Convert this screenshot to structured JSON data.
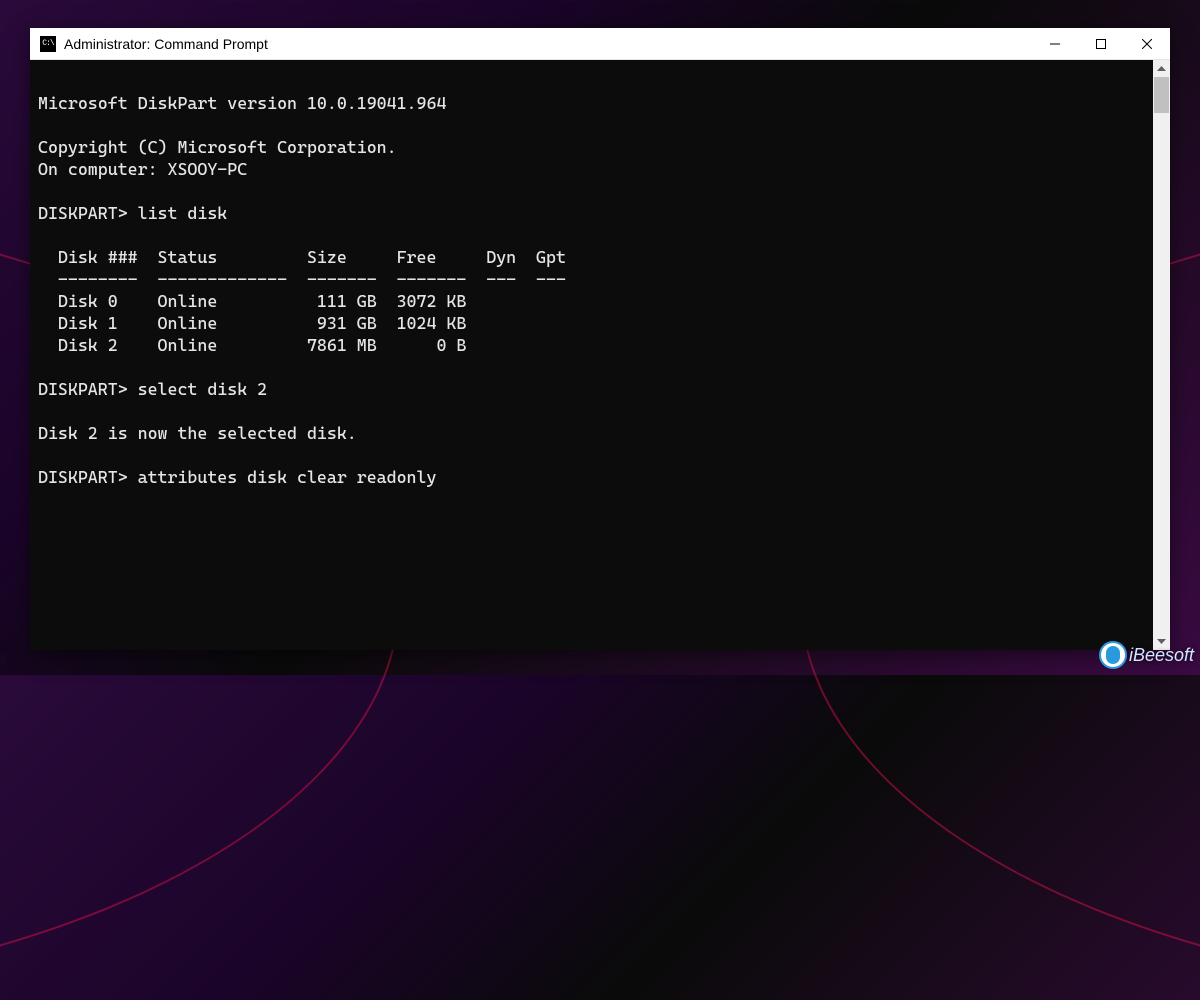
{
  "window": {
    "title": "Administrator: Command Prompt",
    "icon_text": "C:\\"
  },
  "terminal": {
    "lines": {
      "l0": "",
      "l1": "Microsoft DiskPart version 10.0.19041.964",
      "l2": "",
      "l3": "Copyright (C) Microsoft Corporation.",
      "l4": "On computer: XSOOY-PC",
      "l5": "",
      "l6": "DISKPART> list disk",
      "l7": "",
      "l8": "  Disk ###  Status         Size     Free     Dyn  Gpt",
      "l9": "  --------  -------------  -------  -------  ---  ---",
      "l10": "  Disk 0    Online          111 GB  3072 KB",
      "l11": "  Disk 1    Online          931 GB  1024 KB",
      "l12": "  Disk 2    Online         7861 MB      0 B",
      "l13": "",
      "l14": "DISKPART> select disk 2",
      "l15": "",
      "l16": "Disk 2 is now the selected disk.",
      "l17": "",
      "l18": "DISKPART> attributes disk clear readonly",
      "l19": ""
    }
  },
  "watermark": {
    "text": "iBeesoft"
  }
}
